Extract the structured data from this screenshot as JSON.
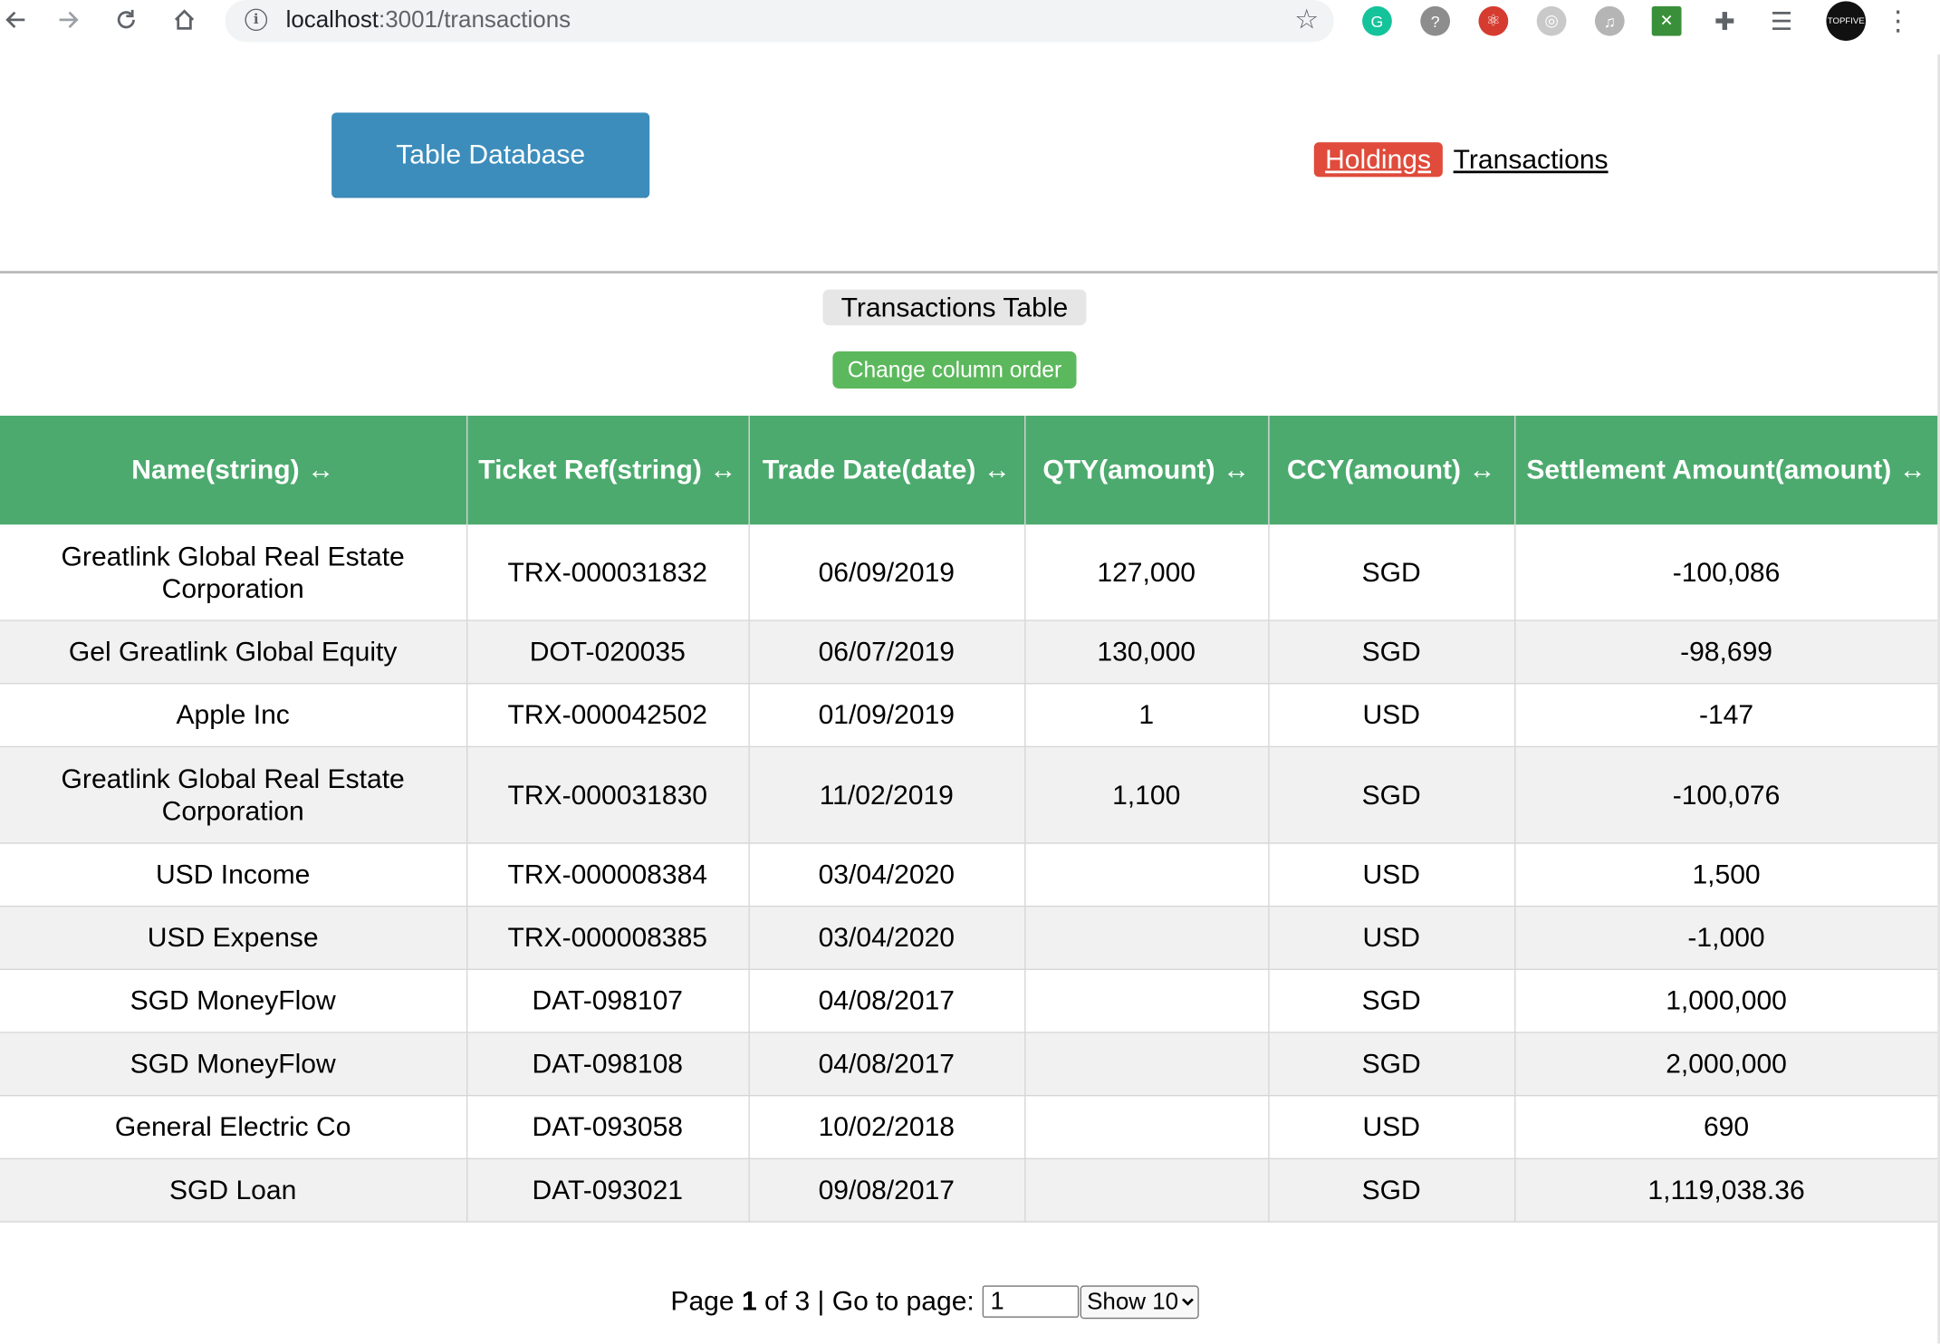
{
  "browser": {
    "url_host": "localhost",
    "url_path": ":3001/transactions",
    "extensions": [
      {
        "name": "grammarly-icon",
        "color": "#15c39a",
        "glyph": "G"
      },
      {
        "name": "chat-extension-icon",
        "color": "#8d8d8d",
        "glyph": "?"
      },
      {
        "name": "react-devtools-icon",
        "color": "#d63b2f",
        "glyph": "⚛"
      },
      {
        "name": "recorder-icon",
        "color": "#c9c9c9",
        "glyph": "◎"
      },
      {
        "name": "music-icon",
        "color": "#b5b5b5",
        "glyph": "♫"
      },
      {
        "name": "figure-extension-icon",
        "color": "#3a8f3a",
        "glyph": "✕"
      },
      {
        "name": "puzzle-icon",
        "color": "#5f6368",
        "glyph": "✚"
      },
      {
        "name": "media-queue-icon",
        "color": "#5f6368",
        "glyph": "☰"
      },
      {
        "name": "topfive-avatar",
        "color": "#111111",
        "glyph": "TOPFIVE"
      }
    ]
  },
  "header": {
    "db_button_label": "Table Database",
    "nav": {
      "holdings": "Holdings",
      "transactions": "Transactions"
    },
    "accent_button": "#3c8dbc",
    "active_nav_color": "#e04b3b"
  },
  "table_title": "Transactions Table",
  "change_column_order_label": "Change column order",
  "table": {
    "header_color": "#4caa6e",
    "columns": [
      "Name(string) ↔",
      "Ticket Ref(string) ↔",
      "Trade Date(date) ↔",
      "QTY(amount) ↔",
      "CCY(amount) ↔",
      "Settlement Amount(amount) ↔"
    ],
    "rows": [
      [
        "Greatlink Global Real Estate Corporation",
        "TRX-000031832",
        "06/09/2019",
        "127,000",
        "SGD",
        "-100,086"
      ],
      [
        "Gel Greatlink Global Equity",
        "DOT-020035",
        "06/07/2019",
        "130,000",
        "SGD",
        "-98,699"
      ],
      [
        "Apple Inc",
        "TRX-000042502",
        "01/09/2019",
        "1",
        "USD",
        "-147"
      ],
      [
        "Greatlink Global Real Estate Corporation",
        "TRX-000031830",
        "11/02/2019",
        "1,100",
        "SGD",
        "-100,076"
      ],
      [
        "USD Income",
        "TRX-000008384",
        "03/04/2020",
        "",
        "USD",
        "1,500"
      ],
      [
        "USD Expense",
        "TRX-000008385",
        "03/04/2020",
        "",
        "USD",
        "-1,000"
      ],
      [
        "SGD MoneyFlow",
        "DAT-098107",
        "04/08/2017",
        "",
        "SGD",
        "1,000,000"
      ],
      [
        "SGD MoneyFlow",
        "DAT-098108",
        "04/08/2017",
        "",
        "SGD",
        "2,000,000"
      ],
      [
        "General Electric Co",
        "DAT-093058",
        "10/02/2018",
        "",
        "USD",
        "690"
      ],
      [
        "SGD Loan",
        "DAT-093021",
        "09/08/2017",
        "",
        "SGD",
        "1,119,038.36"
      ]
    ]
  },
  "pagination": {
    "page_prefix": "Page ",
    "current_page": "1",
    "of_text": " of 3 | Go to page:",
    "goto_value": "1",
    "page_size_options": [
      "Show 10"
    ]
  }
}
